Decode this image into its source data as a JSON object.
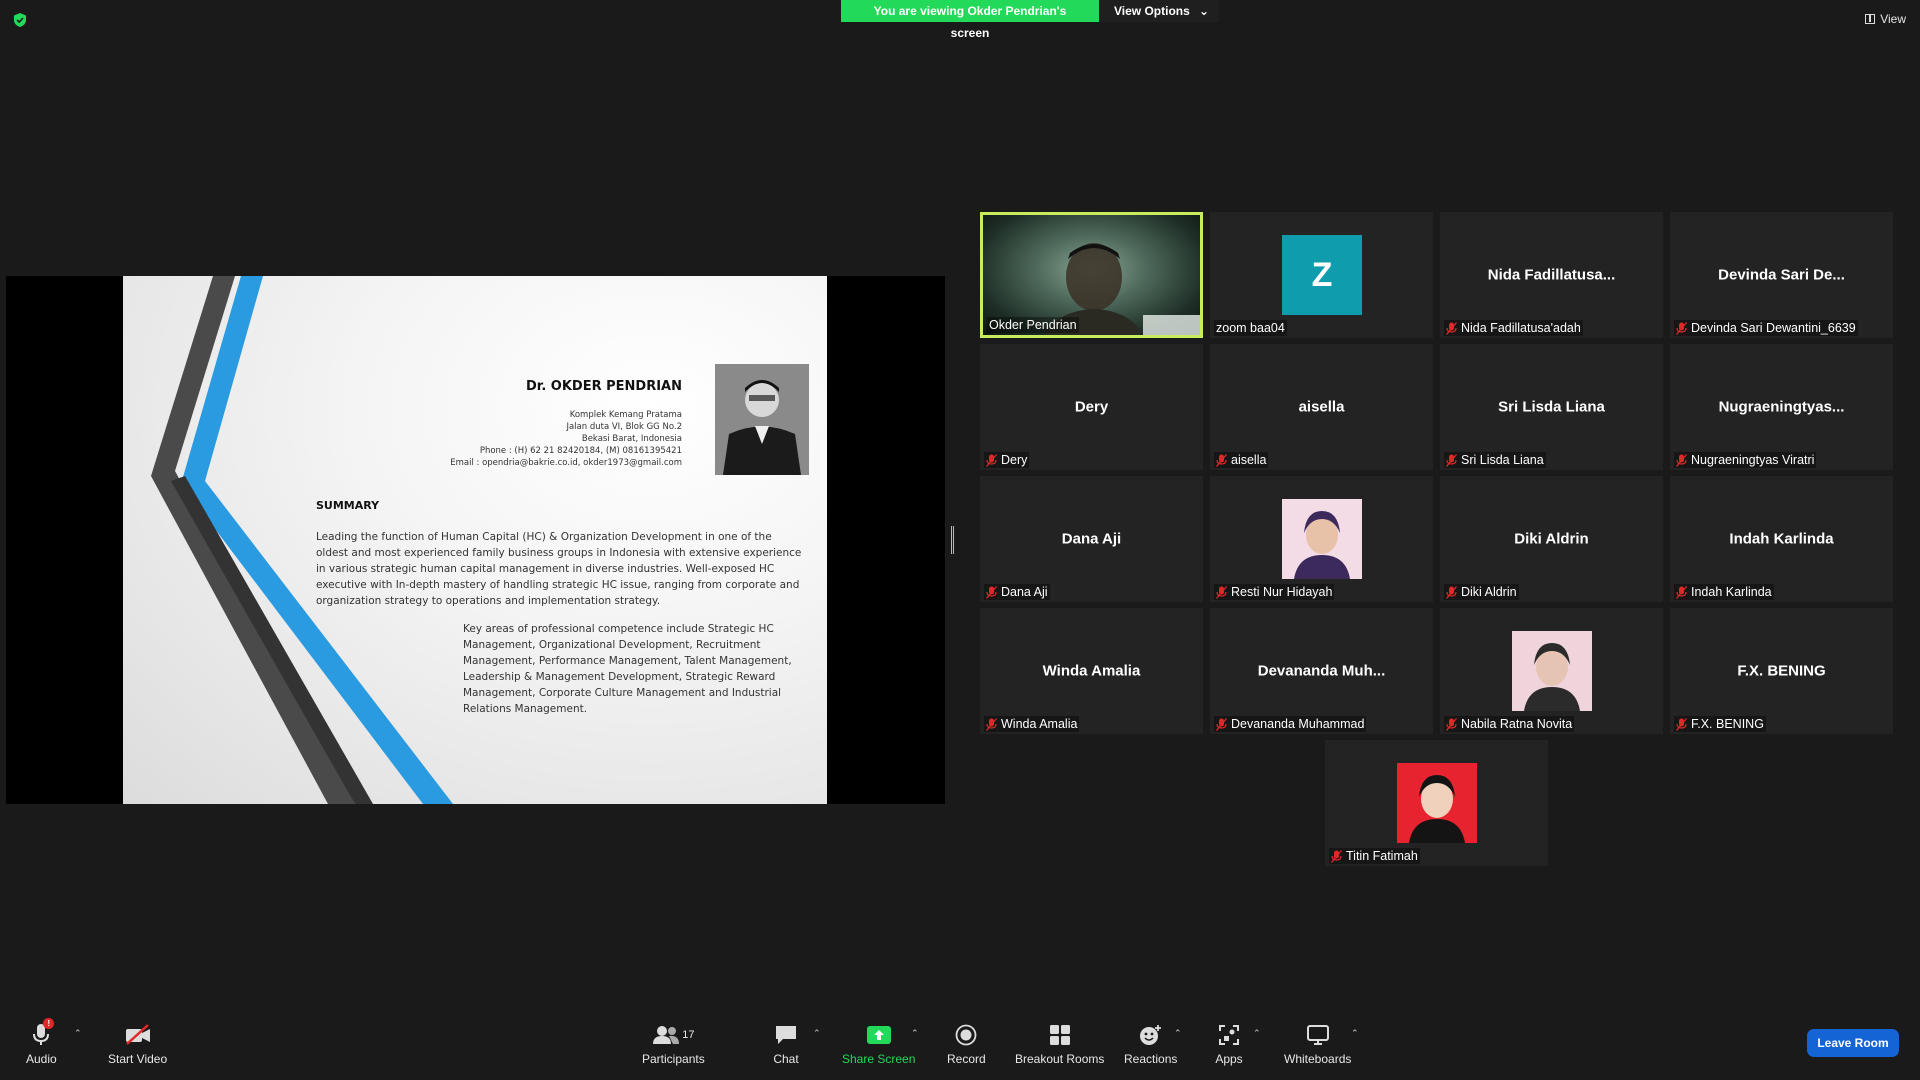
{
  "banner": {
    "text": "You are viewing Okder Pendrian's screen",
    "view_options": "View Options"
  },
  "top_right": {
    "view": "View"
  },
  "slide": {
    "name": "Dr. OKDER PENDRIAN",
    "address": [
      "Komplek Kemang Pratama",
      "Jalan duta VI, Blok GG No.2",
      "Bekasi Barat, Indonesia",
      "Phone :  (H) 62 21 82420184, (M) 08161395421",
      "Email  : opendria@bakrie.co.id,        okder1973@gmail.com"
    ],
    "summary_title": "SUMMARY",
    "summary_p1": "Leading the function of Human Capital (HC) & Organization Development in one of the oldest and most experienced family business groups in Indonesia with extensive experience in various strategic human capital management in diverse industries.  Well-exposed HC executive with In-depth mastery of handling strategic HC issue, ranging from corporate and organization strategy to operations and implementation strategy.",
    "summary_p2": "Key areas of professional competence include Strategic HC Management, Organizational Development, Recruitment Management, Performance Management, Talent Management, Leadership & Management Development, Strategic Reward Management, Corporate Culture Management and Industrial Relations Management."
  },
  "participants": [
    {
      "label": "Okder Pendrian",
      "display": "",
      "type": "video",
      "muted": false,
      "active": true
    },
    {
      "label": "zoom baa04",
      "display": "Z",
      "type": "letter",
      "muted": false
    },
    {
      "label": "Nida Fadillatusa'adah",
      "display": "Nida  Fadillatusa...",
      "type": "name",
      "muted": true
    },
    {
      "label": "Devinda Sari Dewantini_6639",
      "display": "Devinda Sari De...",
      "type": "name",
      "muted": true
    },
    {
      "label": "Dery",
      "display": "Dery",
      "type": "name",
      "muted": true
    },
    {
      "label": "aisella",
      "display": "aisella",
      "type": "name",
      "muted": true
    },
    {
      "label": "Sri Lisda Liana",
      "display": "Sri Lisda Liana",
      "type": "name",
      "muted": true
    },
    {
      "label": "Nugraeningtyas Viratri",
      "display": "Nugraeningtyas...",
      "type": "name",
      "muted": true
    },
    {
      "label": "Dana Aji",
      "display": "Dana Aji",
      "type": "name",
      "muted": true
    },
    {
      "label": "Resti Nur Hidayah",
      "display": "",
      "type": "photo",
      "muted": true
    },
    {
      "label": "Diki Aldrin",
      "display": "Diki Aldrin",
      "type": "name",
      "muted": true
    },
    {
      "label": "Indah Karlinda",
      "display": "Indah Karlinda",
      "type": "name",
      "muted": true
    },
    {
      "label": "Winda Amalia",
      "display": "Winda Amalia",
      "type": "name",
      "muted": true
    },
    {
      "label": "Devananda Muhammad",
      "display": "Devananda  Muh...",
      "type": "name",
      "muted": true
    },
    {
      "label": "Nabila Ratna Novita",
      "display": "",
      "type": "photo",
      "muted": true
    },
    {
      "label": "F.X. BENING",
      "display": "F.X. BENING",
      "type": "name",
      "muted": true
    },
    {
      "label": "Titin Fatimah",
      "display": "",
      "type": "photo",
      "muted": true
    }
  ],
  "toolbar": {
    "audio": "Audio",
    "audio_badge": "!",
    "start_video": "Start Video",
    "participants": "Participants",
    "participants_count": "17",
    "chat": "Chat",
    "share_screen": "Share Screen",
    "record": "Record",
    "breakout_rooms": "Breakout Rooms",
    "reactions": "Reactions",
    "apps": "Apps",
    "whiteboards": "Whiteboards",
    "leave": "Leave Room"
  },
  "colors": {
    "accent_green": "#23d959",
    "active_speaker": "#c7ed5e",
    "leave_blue": "#1564d6",
    "avatar_teal": "#0f9dad",
    "mute_red": "#e02828"
  }
}
